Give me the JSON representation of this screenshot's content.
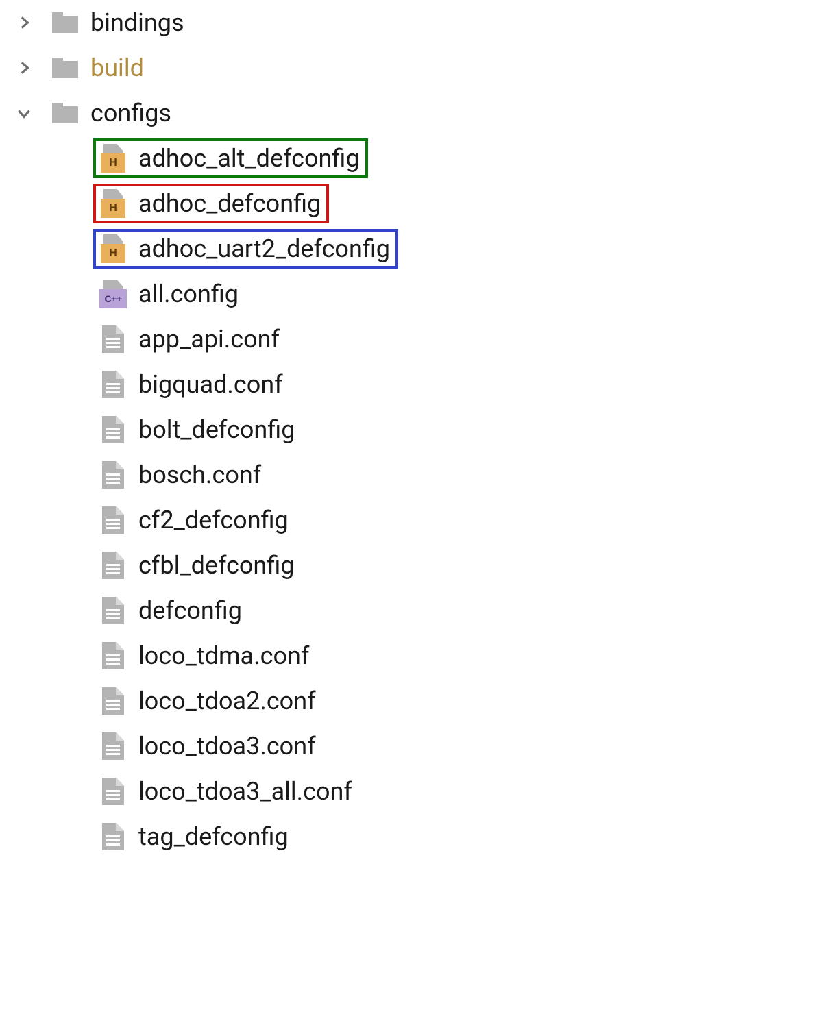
{
  "tree": {
    "folders": {
      "bindings": {
        "label": "bindings",
        "expanded": false
      },
      "build": {
        "label": "build",
        "expanded": false,
        "dimmed": true
      },
      "configs": {
        "label": "configs",
        "expanded": true
      }
    },
    "configs_files": [
      {
        "name": "adhoc_alt_defconfig",
        "icon": "h",
        "highlight": "green"
      },
      {
        "name": "adhoc_defconfig",
        "icon": "h",
        "highlight": "red"
      },
      {
        "name": "adhoc_uart2_defconfig",
        "icon": "h",
        "highlight": "blue"
      },
      {
        "name": "all.config",
        "icon": "cpp",
        "highlight": null
      },
      {
        "name": "app_api.conf",
        "icon": "conf",
        "highlight": null
      },
      {
        "name": "bigquad.conf",
        "icon": "conf",
        "highlight": null
      },
      {
        "name": "bolt_defconfig",
        "icon": "conf",
        "highlight": null
      },
      {
        "name": "bosch.conf",
        "icon": "conf",
        "highlight": null
      },
      {
        "name": "cf2_defconfig",
        "icon": "conf",
        "highlight": null
      },
      {
        "name": "cfbl_defconfig",
        "icon": "conf",
        "highlight": null
      },
      {
        "name": "defconfig",
        "icon": "conf",
        "highlight": null
      },
      {
        "name": "loco_tdma.conf",
        "icon": "conf",
        "highlight": null
      },
      {
        "name": "loco_tdoa2.conf",
        "icon": "conf",
        "highlight": null
      },
      {
        "name": "loco_tdoa3.conf",
        "icon": "conf",
        "highlight": null
      },
      {
        "name": "loco_tdoa3_all.conf",
        "icon": "conf",
        "highlight": null
      },
      {
        "name": "tag_defconfig",
        "icon": "conf",
        "highlight": null
      }
    ]
  },
  "icon_badges": {
    "h": "H",
    "cpp": "C++"
  }
}
